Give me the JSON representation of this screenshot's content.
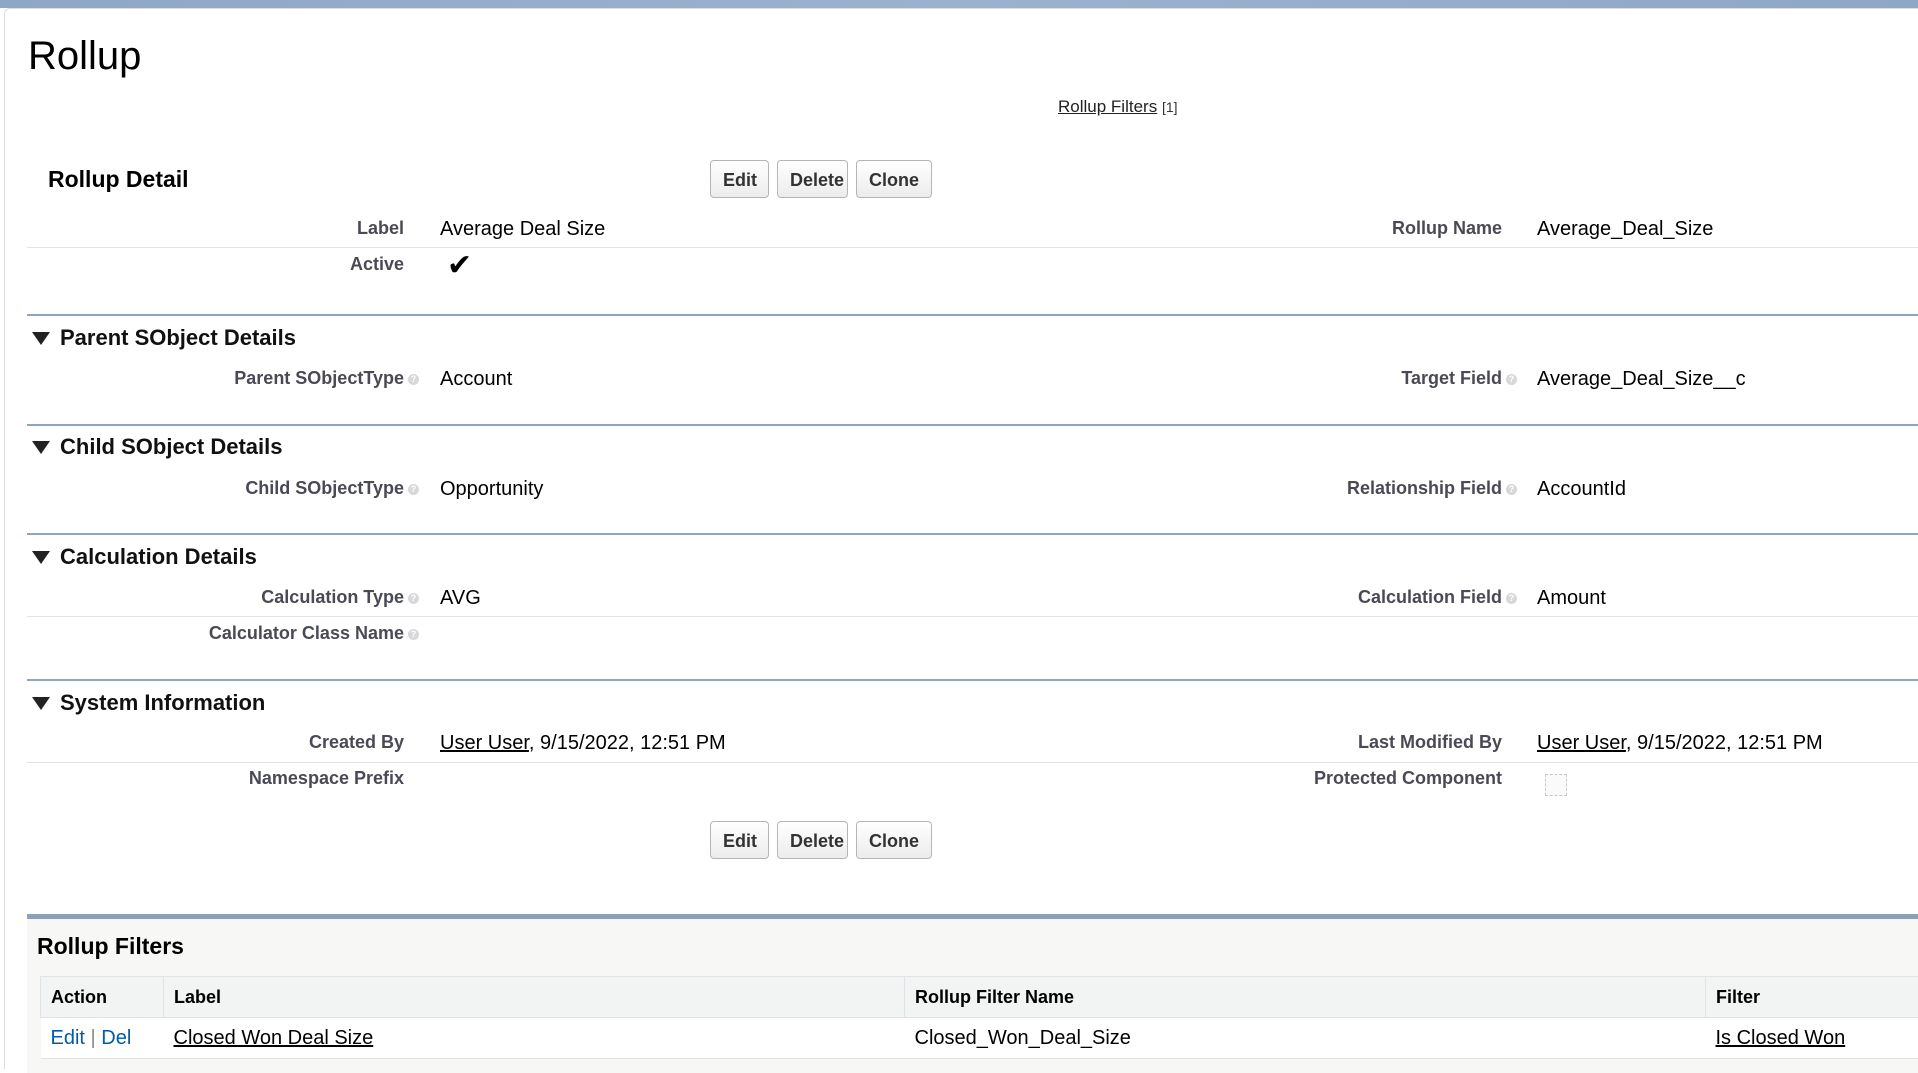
{
  "header": {
    "title": "Rollup",
    "related_link": {
      "label": "Rollup Filters",
      "count": "[1]"
    }
  },
  "detail": {
    "title": "Rollup Detail",
    "buttons": {
      "edit": "Edit",
      "delete": "Delete",
      "clone": "Clone"
    },
    "fields": {
      "label": {
        "label": "Label",
        "value": "Average Deal Size"
      },
      "rollup_name": {
        "label": "Rollup Name",
        "value": "Average_Deal_Size"
      },
      "active": {
        "label": "Active",
        "checked": true
      }
    }
  },
  "sections": {
    "parent": {
      "title": "Parent SObject Details",
      "fields": {
        "parent_sobject_type": {
          "label": "Parent SObjectType",
          "value": "Account"
        },
        "target_field": {
          "label": "Target Field",
          "value": "Average_Deal_Size__c"
        }
      }
    },
    "child": {
      "title": "Child SObject Details",
      "fields": {
        "child_sobject_type": {
          "label": "Child SObjectType",
          "value": "Opportunity"
        },
        "relationship_field": {
          "label": "Relationship Field",
          "value": "AccountId"
        }
      }
    },
    "calculation": {
      "title": "Calculation Details",
      "fields": {
        "calculation_type": {
          "label": "Calculation Type",
          "value": "AVG"
        },
        "calculation_field": {
          "label": "Calculation Field",
          "value": "Amount"
        },
        "calculator_class_name": {
          "label": "Calculator Class Name",
          "value": ""
        }
      }
    },
    "system": {
      "title": "System Information",
      "fields": {
        "created_by": {
          "label": "Created By",
          "user": "User User",
          "datetime": ", 9/15/2022, 12:51 PM"
        },
        "last_modified_by": {
          "label": "Last Modified By",
          "user": "User User",
          "datetime": ", 9/15/2022, 12:51 PM"
        },
        "namespace_prefix": {
          "label": "Namespace Prefix",
          "value": ""
        },
        "protected_component": {
          "label": "Protected Component",
          "checked": false
        }
      }
    }
  },
  "rollup_filters": {
    "title": "Rollup Filters",
    "columns": [
      "Action",
      "Label",
      "Rollup Filter Name",
      "Filter"
    ],
    "rows": [
      {
        "action_edit": "Edit",
        "action_sep": "|",
        "action_del": "Del",
        "label": "Closed Won Deal Size",
        "name": "Closed_Won_Deal_Size",
        "filter": "Is Closed Won"
      }
    ]
  },
  "icons": {
    "help": "help-icon",
    "collapse": "triangle-down-icon",
    "check": "checkmark-icon"
  },
  "colors": {
    "section_rule": "#8fa3c2",
    "related_list_rule": "#8e9fb8",
    "action_link": "#015ba7",
    "top_bar": "#8fa7c6"
  }
}
